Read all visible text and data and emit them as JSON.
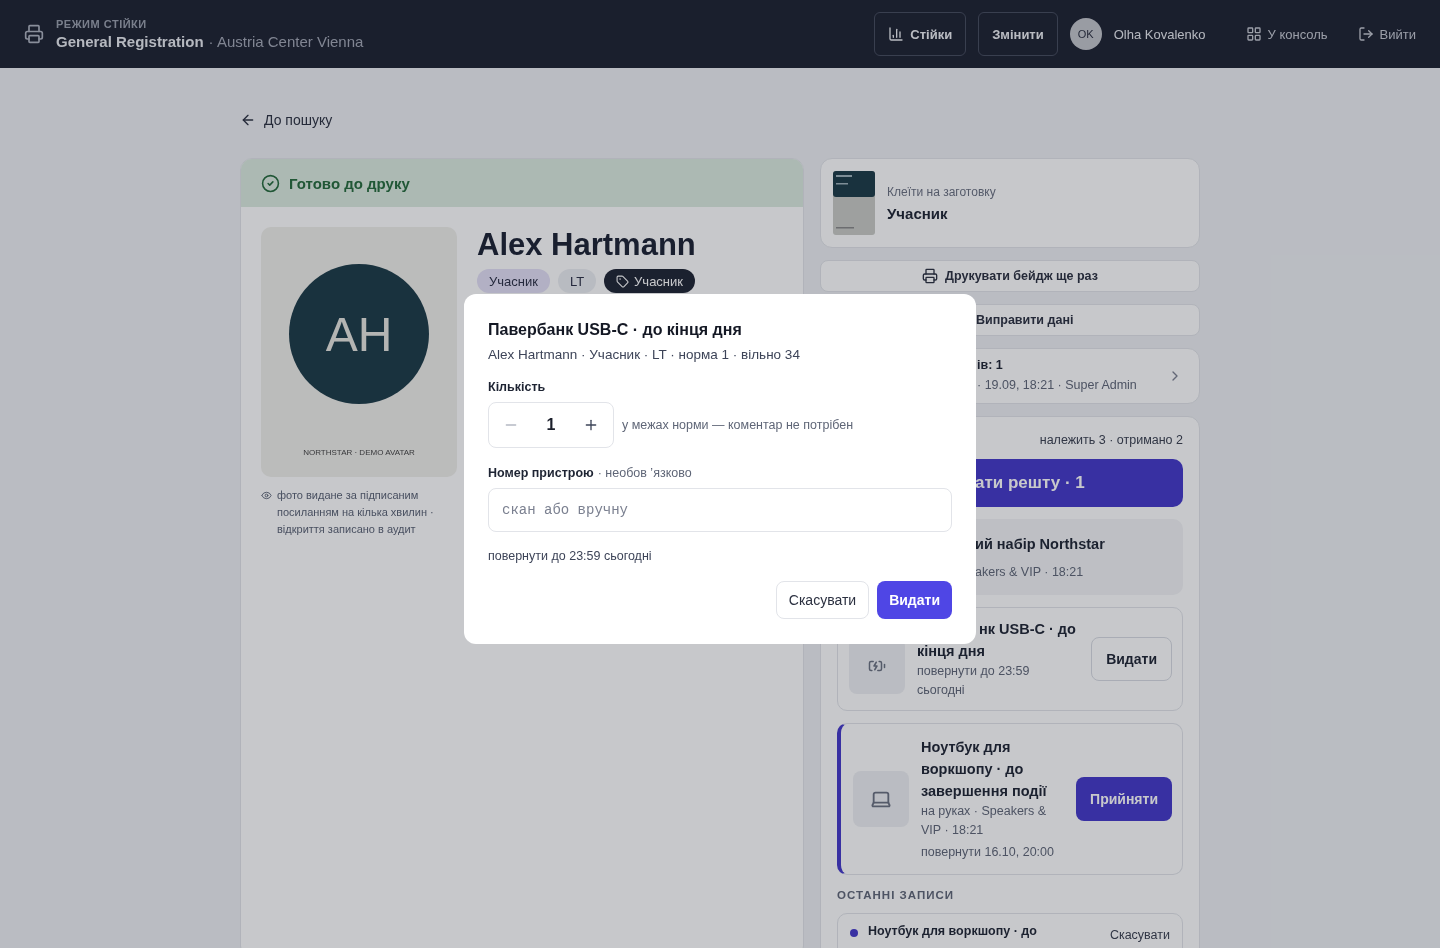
{
  "header": {
    "mode_label": "РЕЖИМ СТІЙКИ",
    "title": "General Registration",
    "venue": "· Austria Center Vienna",
    "buttons": [
      {
        "label": "Стійки",
        "kind": "stats"
      },
      {
        "label": "Змінити",
        "kind": "plain"
      }
    ],
    "user": {
      "initials": "OK",
      "name": "Olha Kovalenko"
    },
    "links": [
      {
        "label": "У консоль",
        "kind": "console"
      },
      {
        "label": "Вийти",
        "kind": "logout"
      }
    ]
  },
  "back_link": "До пошуку",
  "status_banner": "Готово до друку",
  "attendee": {
    "avatar_initials": "AH",
    "avatar_caption": "NORTHSTAR · DEMO AVATAR",
    "photo_note": "фото видане за підписаним посиланням на кілька хвилин · відкриття записано в аудит",
    "name": "Alex Hartmann",
    "tags": [
      {
        "label": "Учасник",
        "kind": "role"
      },
      {
        "label": "LT",
        "kind": "plain"
      },
      {
        "label": "Учасник",
        "kind": "badge"
      }
    ]
  },
  "badge_card": {
    "caption": "Клеїти на заготовку",
    "type": "Учасник"
  },
  "actions": [
    {
      "label": "Друкувати бейдж ще раз",
      "kind": "print"
    },
    {
      "label": "Виправити дані",
      "kind": "plain"
    }
  ],
  "print_count": {
    "title": "ів: 1",
    "meta": "· 19.09, 18:21 · Super Admin"
  },
  "kit": {
    "summary": "належить 3 · отримано 2",
    "primary_button": "ати решту · 1",
    "items": [
      {
        "kind": "done",
        "title": "ий набір Northstar",
        "meta": "akers & VIP · 18:21"
      },
      {
        "kind": "issue",
        "title_fragment": "нк USB-C · до",
        "title_rest": "кінця дня",
        "meta": "повернути до 23:59 сьогодні",
        "button": "Видати"
      },
      {
        "kind": "on_hand",
        "title": "Ноутбук для воркшопу · до завершення події",
        "meta": "на руках · Speakers & VIP · 18:21",
        "due": "повернути 16.10, 20:00",
        "button": "Прийняти"
      }
    ]
  },
  "log": {
    "heading": "ОСТАННІ ЗАПИСИ",
    "entries": [
      {
        "text": "Ноутбук для воркшопу · до",
        "action": "Скасувати"
      }
    ]
  },
  "modal": {
    "title": "Павербанк USB-C · до кінця дня",
    "subtitle": "Alex Hartmann · Учасник · LT · норма 1 · вільно 34",
    "quantity_label": "Кількість",
    "quantity": "1",
    "quantity_hint": "у межах норми — коментар не потрібен",
    "device_label": "Номер пристрою",
    "device_hint": "· необов ʼязково",
    "device_placeholder": "скан або вручну",
    "due": "повернути до 23:59 сьогодні",
    "buttons": [
      {
        "label": "Скасувати",
        "kind": "secondary"
      },
      {
        "label": "Видати",
        "kind": "primary"
      }
    ]
  }
}
